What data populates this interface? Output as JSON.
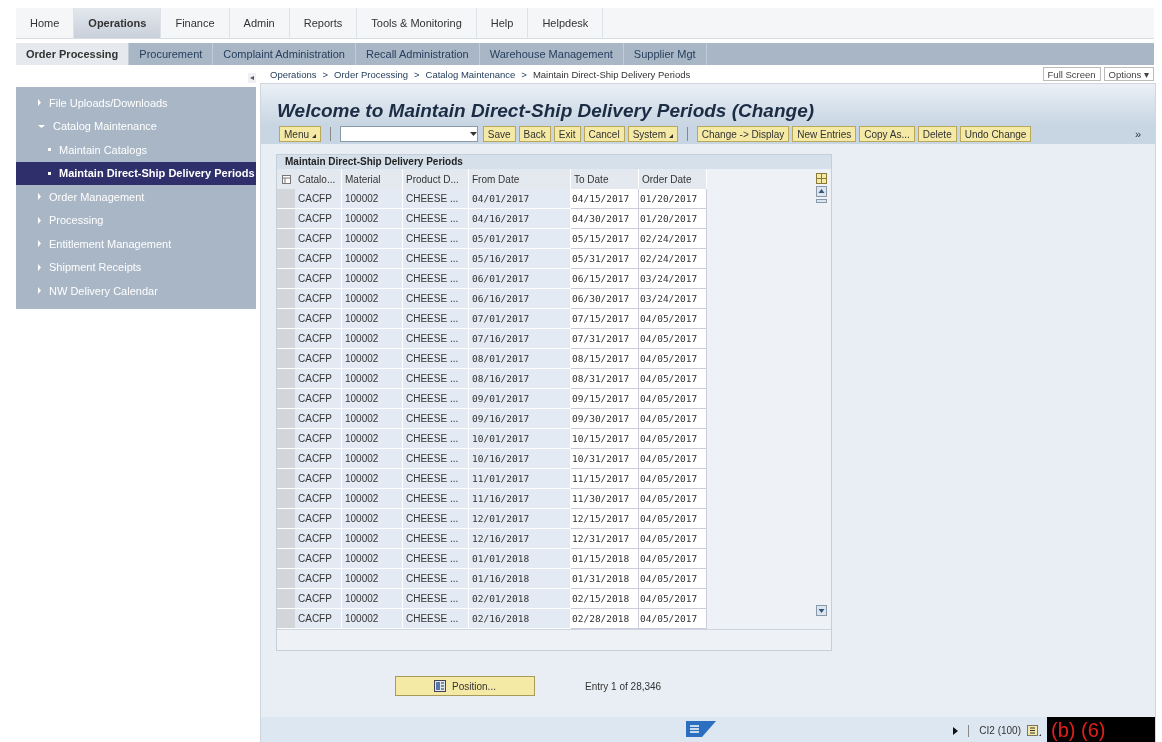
{
  "top_tabs": [
    {
      "label": "Home",
      "selected": false
    },
    {
      "label": "Operations",
      "selected": true
    },
    {
      "label": "Finance",
      "selected": false
    },
    {
      "label": "Admin",
      "selected": false
    },
    {
      "label": "Reports",
      "selected": false
    },
    {
      "label": "Tools & Monitoring",
      "selected": false
    },
    {
      "label": "Help",
      "selected": false
    },
    {
      "label": "Helpdesk",
      "selected": false
    }
  ],
  "sub_tabs": [
    {
      "label": "Order Processing",
      "selected": true
    },
    {
      "label": "Procurement",
      "selected": false
    },
    {
      "label": "Complaint Administration",
      "selected": false
    },
    {
      "label": "Recall Administration",
      "selected": false
    },
    {
      "label": "Warehouse Management",
      "selected": false
    },
    {
      "label": "Supplier Mgt",
      "selected": false
    }
  ],
  "collapse_button": "◂",
  "breadcrumb": [
    "Operations",
    "Order Processing",
    "Catalog Maintenance",
    "Maintain Direct-Ship Delivery Periods"
  ],
  "breadcrumb_separator": ">",
  "view_buttons": [
    "Full Screen",
    "Options ▾"
  ],
  "sidebar": {
    "items": [
      {
        "label": "File Uploads/Downloads",
        "expanded": false,
        "selected": false
      },
      {
        "label": "Catalog Maintenance",
        "expanded": true,
        "selected": false,
        "children": [
          {
            "label": "Maintain Catalogs",
            "selected": false
          },
          {
            "label": "Maintain Direct-Ship Delivery Periods",
            "selected": true
          }
        ]
      },
      {
        "label": "Order Management",
        "expanded": false,
        "selected": false
      },
      {
        "label": "Processing",
        "expanded": false,
        "selected": false
      },
      {
        "label": "Entitlement Management",
        "expanded": false,
        "selected": false
      },
      {
        "label": "Shipment Receipts",
        "expanded": false,
        "selected": false
      },
      {
        "label": "NW Delivery Calendar",
        "expanded": false,
        "selected": false
      }
    ]
  },
  "page_title": "Welcome to Maintain Direct-Ship Delivery Periods (Change)",
  "toolbar": {
    "groups": [
      [
        {
          "label": "Menu",
          "menu": true
        }
      ],
      [
        {
          "kind": "combo"
        },
        {
          "label": "Save",
          "menu": false
        },
        {
          "label": "Back",
          "menu": false
        },
        {
          "label": "Exit",
          "menu": false
        },
        {
          "label": "Cancel",
          "menu": false
        },
        {
          "label": "System",
          "menu": true
        }
      ],
      [
        {
          "label": "Change -> Display",
          "menu": false
        },
        {
          "label": "New Entries",
          "menu": false
        },
        {
          "label": "Copy As...",
          "menu": false
        },
        {
          "label": "Delete",
          "menu": false
        },
        {
          "label": "Undo Change",
          "menu": false
        }
      ]
    ],
    "more": "»"
  },
  "table": {
    "title": "Maintain Direct-Ship Delivery Periods",
    "columns": [
      "Catalo...",
      "Material",
      "Product D...",
      "From Date",
      "To Date",
      "Order Date"
    ],
    "rows": [
      [
        "CACFP",
        "100002",
        "CHEESE ...",
        "04/01/2017",
        "04/15/2017",
        "01/20/2017"
      ],
      [
        "CACFP",
        "100002",
        "CHEESE ...",
        "04/16/2017",
        "04/30/2017",
        "01/20/2017"
      ],
      [
        "CACFP",
        "100002",
        "CHEESE ...",
        "05/01/2017",
        "05/15/2017",
        "02/24/2017"
      ],
      [
        "CACFP",
        "100002",
        "CHEESE ...",
        "05/16/2017",
        "05/31/2017",
        "02/24/2017"
      ],
      [
        "CACFP",
        "100002",
        "CHEESE ...",
        "06/01/2017",
        "06/15/2017",
        "03/24/2017"
      ],
      [
        "CACFP",
        "100002",
        "CHEESE ...",
        "06/16/2017",
        "06/30/2017",
        "03/24/2017"
      ],
      [
        "CACFP",
        "100002",
        "CHEESE ...",
        "07/01/2017",
        "07/15/2017",
        "04/05/2017"
      ],
      [
        "CACFP",
        "100002",
        "CHEESE ...",
        "07/16/2017",
        "07/31/2017",
        "04/05/2017"
      ],
      [
        "CACFP",
        "100002",
        "CHEESE ...",
        "08/01/2017",
        "08/15/2017",
        "04/05/2017"
      ],
      [
        "CACFP",
        "100002",
        "CHEESE ...",
        "08/16/2017",
        "08/31/2017",
        "04/05/2017"
      ],
      [
        "CACFP",
        "100002",
        "CHEESE ...",
        "09/01/2017",
        "09/15/2017",
        "04/05/2017"
      ],
      [
        "CACFP",
        "100002",
        "CHEESE ...",
        "09/16/2017",
        "09/30/2017",
        "04/05/2017"
      ],
      [
        "CACFP",
        "100002",
        "CHEESE ...",
        "10/01/2017",
        "10/15/2017",
        "04/05/2017"
      ],
      [
        "CACFP",
        "100002",
        "CHEESE ...",
        "10/16/2017",
        "10/31/2017",
        "04/05/2017"
      ],
      [
        "CACFP",
        "100002",
        "CHEESE ...",
        "11/01/2017",
        "11/15/2017",
        "04/05/2017"
      ],
      [
        "CACFP",
        "100002",
        "CHEESE ...",
        "11/16/2017",
        "11/30/2017",
        "04/05/2017"
      ],
      [
        "CACFP",
        "100002",
        "CHEESE ...",
        "12/01/2017",
        "12/15/2017",
        "04/05/2017"
      ],
      [
        "CACFP",
        "100002",
        "CHEESE ...",
        "12/16/2017",
        "12/31/2017",
        "04/05/2017"
      ],
      [
        "CACFP",
        "100002",
        "CHEESE ...",
        "01/01/2018",
        "01/15/2018",
        "04/05/2017"
      ],
      [
        "CACFP",
        "100002",
        "CHEESE ...",
        "01/16/2018",
        "01/31/2018",
        "04/05/2017"
      ],
      [
        "CACFP",
        "100002",
        "CHEESE ...",
        "02/01/2018",
        "02/15/2018",
        "04/05/2017"
      ],
      [
        "CACFP",
        "100002",
        "CHEESE ...",
        "02/16/2018",
        "02/28/2018",
        "04/05/2017"
      ]
    ]
  },
  "position_button": "Position...",
  "entry_count": "Entry 1 of 28,346",
  "status_bar": {
    "system": "CI2 (100)",
    "redaction": "(b) (6)"
  }
}
